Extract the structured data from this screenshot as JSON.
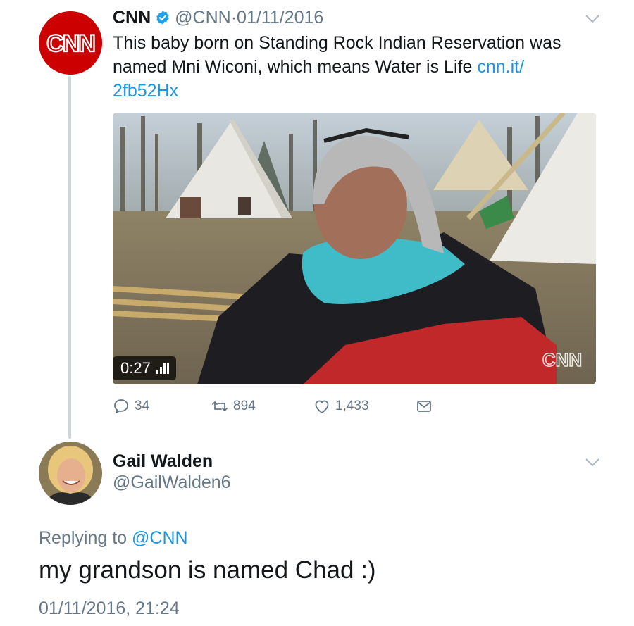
{
  "tweet": {
    "avatar_logo": "CNN",
    "author_name": "CNN",
    "verified_icon": "verified-badge-icon",
    "handle": "@CNN",
    "separator": "·",
    "date": "01/11/2016",
    "text_before_link": "This baby born on Standing Rock Indian Reservation was named Mni Wiconi, which means Water is Life ",
    "link_text": "cnn.it/ 2fb52Hx",
    "video": {
      "duration": "0:27",
      "watermark": "CNN"
    },
    "actions": {
      "reply_count": "34",
      "retweet_count": "894",
      "like_count": "1,433"
    }
  },
  "reply": {
    "author_name": "Gail Walden",
    "handle": "@GailWalden6",
    "replying_prefix": "Replying to ",
    "replying_to": "@CNN",
    "text": "my grandson is named Chad :)",
    "timestamp": "01/11/2016, 21:24"
  },
  "colors": {
    "link": "#1b95e0",
    "muted": "#657786",
    "cnn_red": "#cc0000",
    "thread_line": "#ccd6dd"
  }
}
